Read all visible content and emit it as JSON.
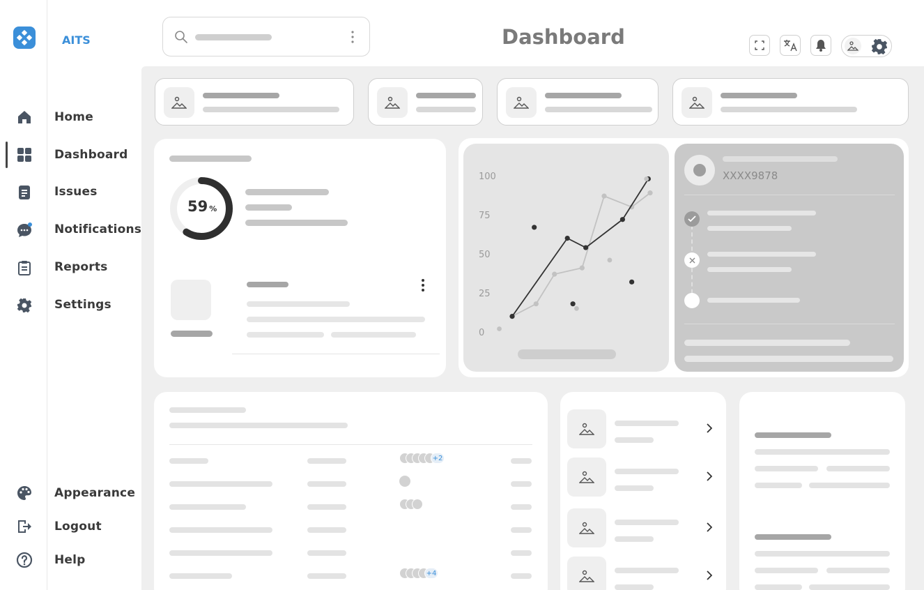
{
  "app": {
    "brand": "AITS",
    "title": "Dashboard"
  },
  "nav": {
    "items": [
      {
        "label": "Home",
        "icon": "home-icon"
      },
      {
        "label": "Dashboard",
        "icon": "grid-icon",
        "active": true
      },
      {
        "label": "Issues",
        "icon": "document-icon"
      },
      {
        "label": "Notifications",
        "icon": "chat-bubble-icon"
      },
      {
        "label": "Reports",
        "icon": "clipboard-icon"
      },
      {
        "label": "Settings",
        "icon": "gear-icon"
      }
    ],
    "bottom": [
      {
        "label": "Appearance",
        "icon": "palette-icon"
      },
      {
        "label": "Logout",
        "icon": "logout-icon"
      },
      {
        "label": "Help",
        "icon": "help-icon"
      }
    ]
  },
  "topbar": {
    "icons": [
      "fullscreen-icon",
      "translate-icon",
      "bell-icon",
      "image-icon",
      "gear-icon"
    ]
  },
  "progress": {
    "value": 59,
    "label": "59",
    "unit": "%"
  },
  "account": {
    "masked": "XXXX9878"
  },
  "table": {
    "avatar_more_1": "+2",
    "avatar_more_2": "+4"
  },
  "chart_data": {
    "type": "line",
    "y_ticks": [
      "100",
      "75",
      "50",
      "25",
      "0"
    ],
    "ylim": [
      0,
      100
    ],
    "series": [
      {
        "color": "#333333",
        "values": [
          [
            0,
            10
          ],
          [
            3,
            60
          ],
          [
            4,
            54
          ],
          [
            6,
            72
          ],
          [
            7.4,
            98
          ]
        ]
      },
      {
        "color": "#c2c2c2",
        "values": [
          [
            0,
            10
          ],
          [
            1.3,
            18
          ],
          [
            2.3,
            37
          ],
          [
            3.8,
            41
          ],
          [
            5,
            87
          ],
          [
            6.5,
            80
          ],
          [
            7.5,
            89
          ]
        ]
      }
    ],
    "scatter_dark": [
      [
        1.2,
        67
      ],
      [
        3.3,
        18
      ],
      [
        6.5,
        32
      ]
    ],
    "scatter_light": [
      [
        -0.7,
        2
      ],
      [
        3.5,
        15
      ],
      [
        5.3,
        46
      ],
      [
        7.3,
        98
      ]
    ],
    "colors": {
      "accent": "#3b8fd9",
      "dark": "#333333",
      "light": "#c2c2c2"
    }
  }
}
